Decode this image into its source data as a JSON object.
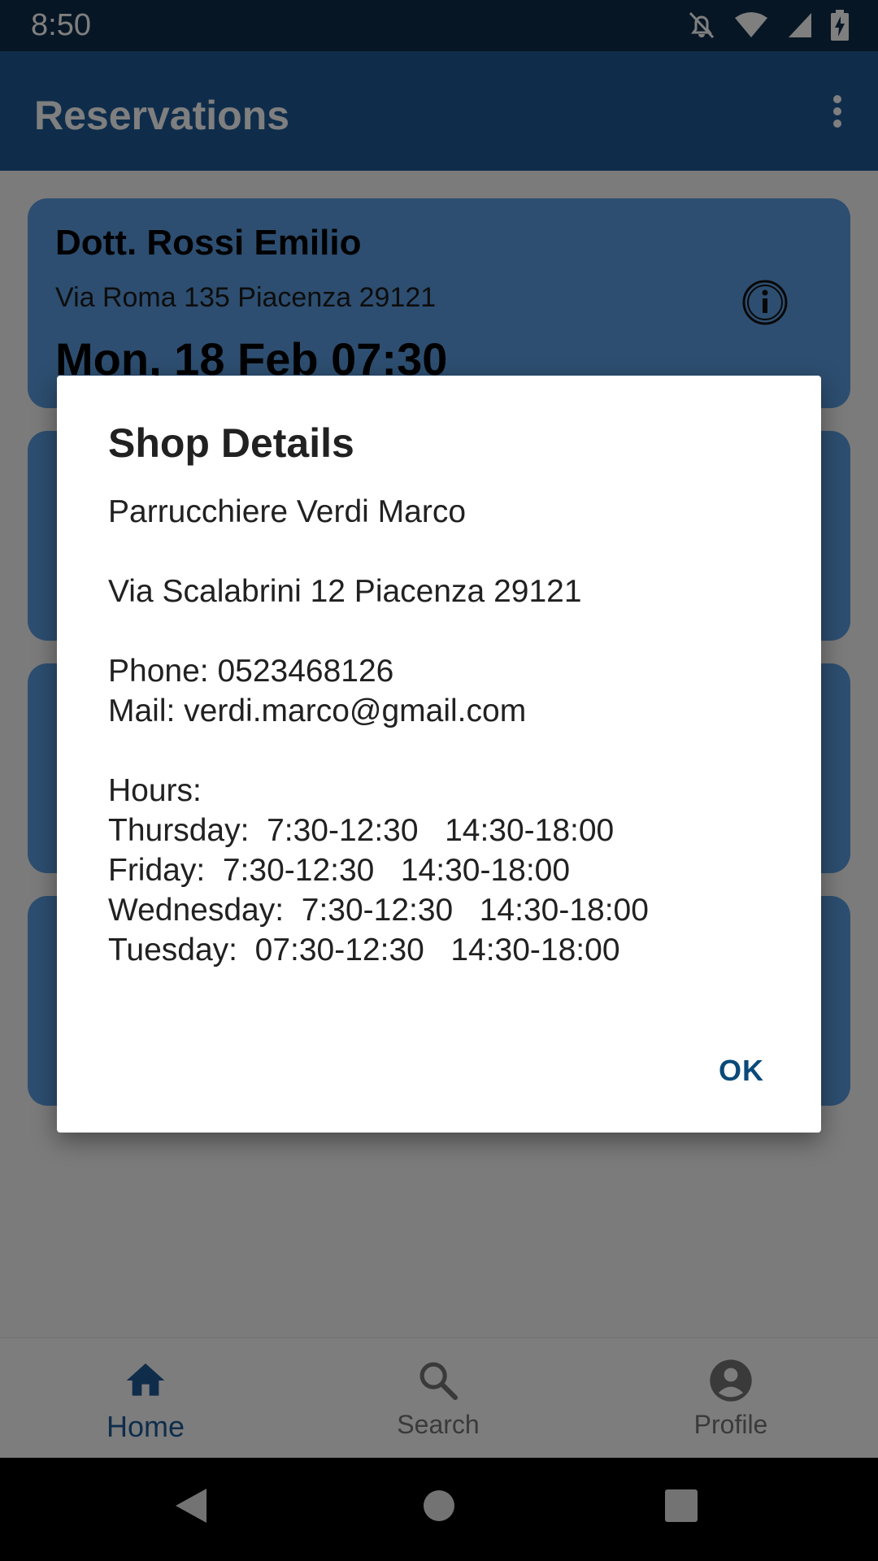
{
  "status_bar": {
    "time": "8:50",
    "icons": [
      "notifications-off-icon",
      "wifi-icon",
      "signal-icon",
      "battery-charging-icon"
    ]
  },
  "app_bar": {
    "title": "Reservations",
    "menu_icon": "more-vert-icon"
  },
  "reservations": [
    {
      "name": "Dott. Rossi Emilio",
      "address": "Via Roma 135 Piacenza 29121",
      "date": "Mon, 18 Feb 07:30"
    }
  ],
  "dialog": {
    "title": "Shop Details",
    "shop_name": "Parrucchiere Verdi Marco",
    "address": "Via Scalabrini 12 Piacenza 29121",
    "phone": "Phone: 0523468126",
    "mail": "Mail: verdi.marco@gmail.com",
    "hours_label": "Hours:",
    "hours": [
      "Thursday:  7:30-12:30   14:30-18:00",
      "Friday:  7:30-12:30   14:30-18:00",
      "Wednesday:  7:30-12:30   14:30-18:00",
      "Tuesday:  07:30-12:30   14:30-18:00"
    ],
    "ok_label": "OK"
  },
  "bottom_nav": {
    "items": [
      {
        "label": "Home",
        "icon": "home-icon",
        "active": true
      },
      {
        "label": "Search",
        "icon": "search-icon",
        "active": false
      },
      {
        "label": "Profile",
        "icon": "account-circle-icon",
        "active": false
      }
    ]
  },
  "colors": {
    "primary": "#1f5a96",
    "primary_dark": "#0f2c4a",
    "card": "#5b9ce0",
    "dialog_button": "#0a4a7a"
  }
}
